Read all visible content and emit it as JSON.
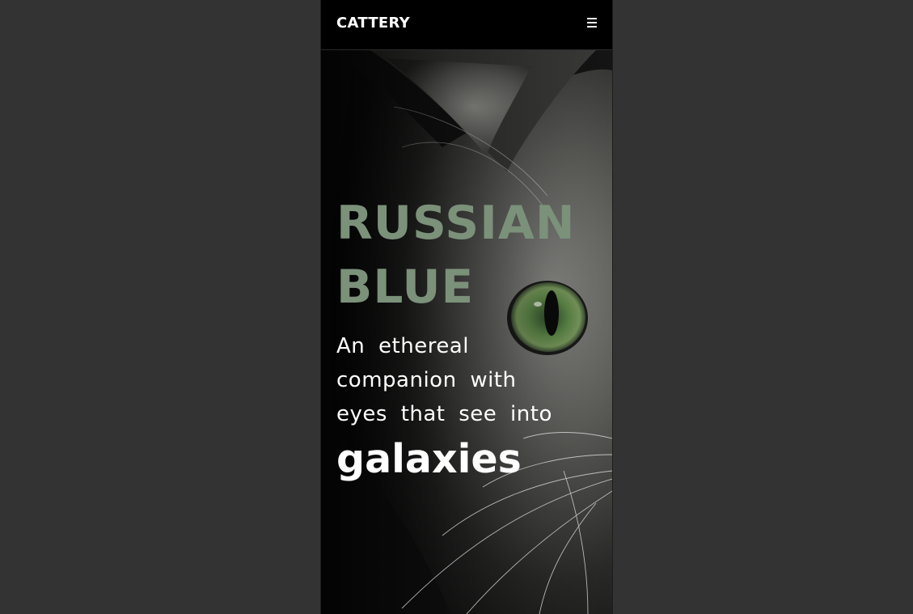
{
  "nav": {
    "brand": "CATTERY",
    "menu_icon": "hamburger-menu-icon"
  },
  "hero": {
    "title_line1": "RUSSIAN",
    "title_line2": "BLUE",
    "tagline_line1": "An ethereal",
    "tagline_line2": "companion with",
    "tagline_line3": "eyes that see into",
    "highlight": "galaxies",
    "image": "russian-blue-cat-photo"
  },
  "colors": {
    "page_bg": "#333333",
    "nav_bg": "#000000",
    "title": "#7b917a",
    "text": "#ffffff",
    "eye": "#5f8a4a"
  }
}
